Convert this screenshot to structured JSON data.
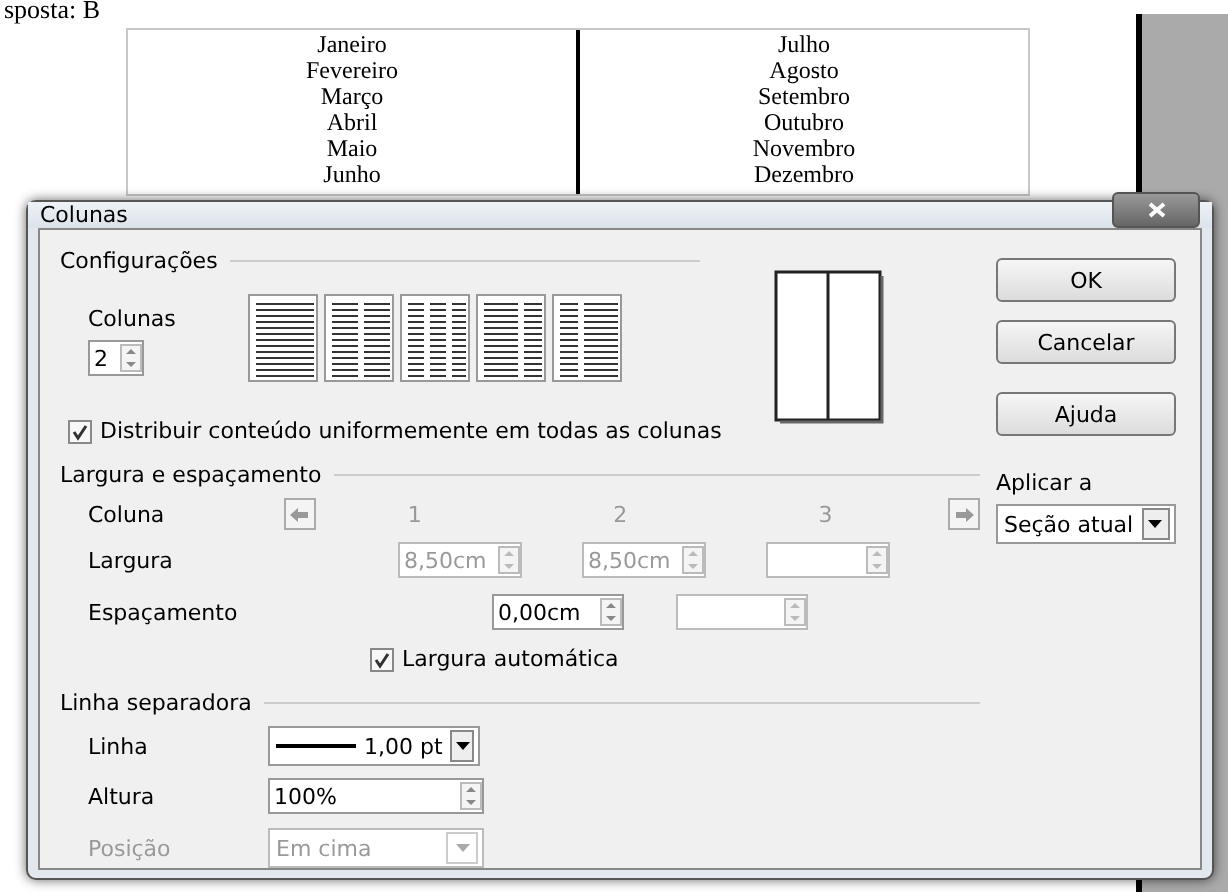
{
  "document": {
    "heading": "sposta: B",
    "table": {
      "columns": [
        [
          "Janeiro",
          "Fevereiro",
          "Março",
          "Abril",
          "Maio",
          "Junho"
        ],
        [
          "Julho",
          "Agosto",
          "Setembro",
          "Outubro",
          "Novembro",
          "Dezembro"
        ]
      ]
    }
  },
  "dialog": {
    "title": "Colunas",
    "settings": {
      "title": "Configurações",
      "columns_label": "Colunas",
      "columns_value": "2",
      "presets": [
        {
          "kind": "one"
        },
        {
          "kind": "two"
        },
        {
          "kind": "three"
        },
        {
          "kind": "left-wide"
        },
        {
          "kind": "right-wide"
        }
      ],
      "distribute": {
        "label": "Distribuir conteúdo uniformemente em todas as colunas",
        "checked": true
      }
    },
    "width_spacing": {
      "title": "Largura e espaçamento",
      "column_label": "Coluna",
      "column_numbers": [
        "1",
        "2",
        "3"
      ],
      "width_label": "Largura",
      "widths": [
        {
          "value": "8,50cm",
          "disabled": true
        },
        {
          "value": "8,50cm",
          "disabled": true
        },
        {
          "disabled": true
        }
      ],
      "spacing_label": "Espaçamento",
      "spacings": [
        {
          "value": "0,00cm",
          "disabled": false
        },
        {
          "disabled": true
        }
      ],
      "auto_width": {
        "label": "Largura automática",
        "checked": true
      }
    },
    "separator": {
      "title": "Linha separadora",
      "line_label": "Linha",
      "line_value": "1,00 pt",
      "height_label": "Altura",
      "height_value": "100%",
      "position_label": "Posição",
      "position_value": "Em cima",
      "position_disabled": true
    },
    "buttons": [
      {
        "label": "OK"
      },
      {
        "label": "Cancelar"
      },
      {
        "label": "Ajuda"
      }
    ],
    "apply_to": {
      "label": "Aplicar a",
      "value": "Seção atual"
    }
  }
}
